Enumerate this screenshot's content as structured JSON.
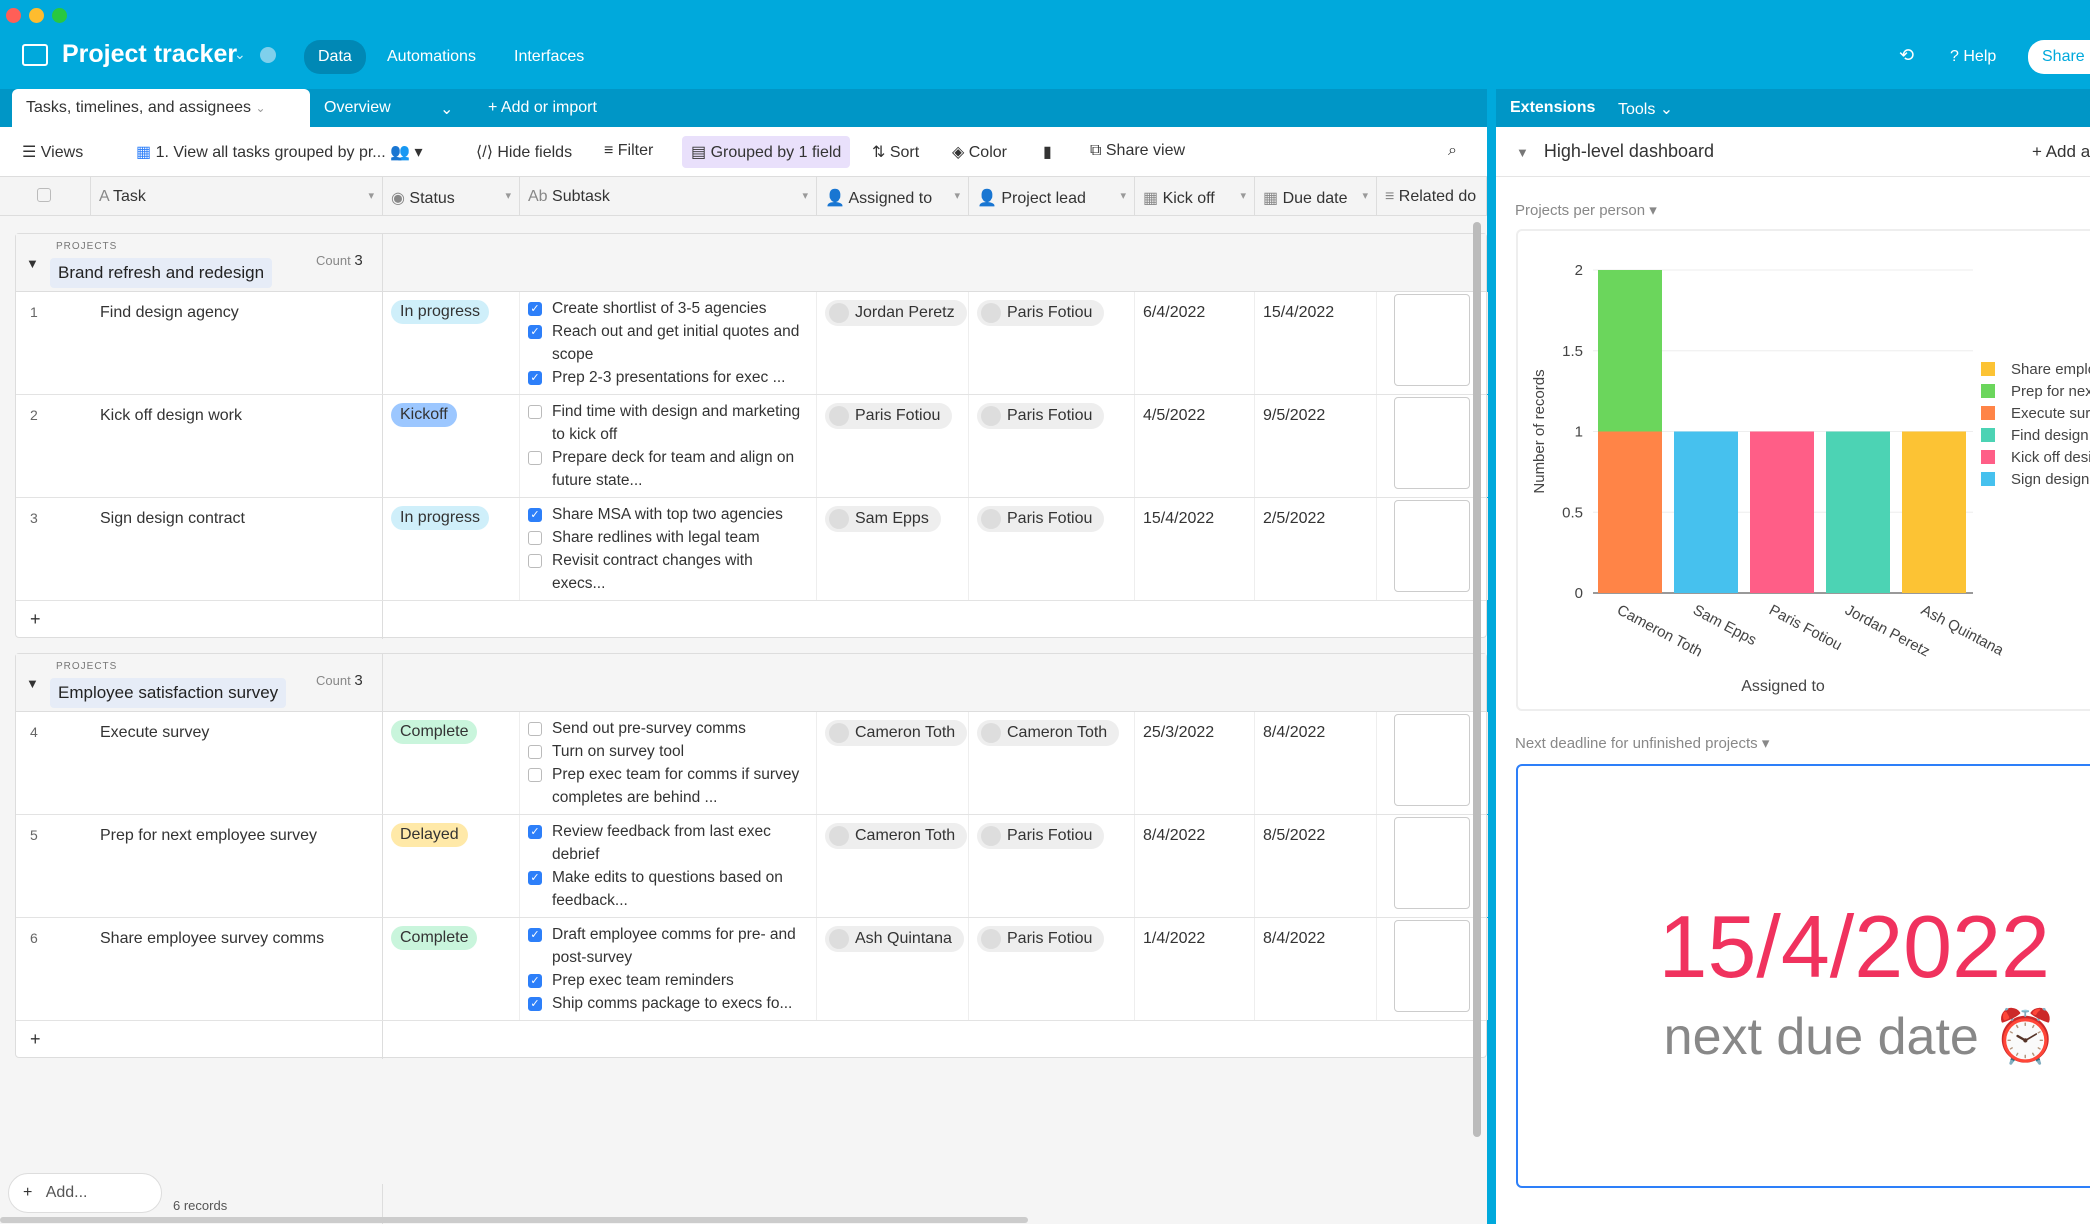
{
  "app": {
    "title": "Project tracker",
    "nav": [
      "Data",
      "Automations",
      "Interfaces"
    ],
    "help": "Help",
    "share": "Share"
  },
  "tabs": {
    "active": "Tasks, timelines, and assignees",
    "overview": "Overview",
    "add": "Add or import"
  },
  "toolbar": {
    "views": "Views",
    "view_name": "1. View all tasks grouped by pr...",
    "hide": "Hide fields",
    "filter": "Filter",
    "grouped": "Grouped by 1 field",
    "sort": "Sort",
    "color": "Color",
    "share": "Share view"
  },
  "columns": [
    "Task",
    "Status",
    "Subtask",
    "Assigned to",
    "Project lead",
    "Kick off",
    "Due date",
    "Related do"
  ],
  "status_colors": {
    "In progress": "#cfeffa",
    "Kickoff": "#9cc7ff",
    "Complete": "#c9f5dc",
    "Delayed": "#ffe9a8"
  },
  "groups": [
    {
      "label": "PROJECTS",
      "name": "Brand refresh and redesign",
      "count_label": "Count",
      "count": "3",
      "rows": [
        {
          "n": "1",
          "task": "Find design agency",
          "status": "In progress",
          "subtasks": [
            {
              "t": "Create shortlist of 3-5 agencies",
              "c": true
            },
            {
              "t": "Reach out and get initial quotes and scope",
              "c": true
            },
            {
              "t": "Prep 2-3 presentations for exec ...",
              "c": true
            }
          ],
          "assigned": "Jordan Peretz",
          "lead": "Paris Fotiou",
          "kickoff": "6/4/2022",
          "due": "15/4/2022"
        },
        {
          "n": "2",
          "task": "Kick off design work",
          "status": "Kickoff",
          "subtasks": [
            {
              "t": "Find time with design and marketing to kick off",
              "c": false
            },
            {
              "t": "Prepare deck for team and align on future state...",
              "c": false
            }
          ],
          "assigned": "Paris Fotiou",
          "lead": "Paris Fotiou",
          "kickoff": "4/5/2022",
          "due": "9/5/2022"
        },
        {
          "n": "3",
          "task": "Sign design contract",
          "status": "In progress",
          "subtasks": [
            {
              "t": "Share MSA with top two agencies",
              "c": true
            },
            {
              "t": "Share redlines with legal team",
              "c": false
            },
            {
              "t": "Revisit contract changes with execs...",
              "c": false
            }
          ],
          "assigned": "Sam Epps",
          "lead": "Paris Fotiou",
          "kickoff": "15/4/2022",
          "due": "2/5/2022"
        }
      ]
    },
    {
      "label": "PROJECTS",
      "name": "Employee satisfaction survey",
      "count_label": "Count",
      "count": "3",
      "rows": [
        {
          "n": "4",
          "task": "Execute survey",
          "status": "Complete",
          "subtasks": [
            {
              "t": "Send out pre-survey comms",
              "c": false
            },
            {
              "t": "Turn on survey tool",
              "c": false
            },
            {
              "t": "Prep exec team for comms if survey completes are behind ...",
              "c": false
            }
          ],
          "assigned": "Cameron Toth",
          "lead": "Cameron Toth",
          "kickoff": "25/3/2022",
          "due": "8/4/2022"
        },
        {
          "n": "5",
          "task": "Prep for next employee survey",
          "status": "Delayed",
          "subtasks": [
            {
              "t": "Review feedback from last exec debrief",
              "c": true
            },
            {
              "t": "Make edits to questions based on feedback...",
              "c": true
            }
          ],
          "assigned": "Cameron Toth",
          "lead": "Paris Fotiou",
          "kickoff": "8/4/2022",
          "due": "8/5/2022"
        },
        {
          "n": "6",
          "task": "Share employee survey comms",
          "status": "Complete",
          "subtasks": [
            {
              "t": "Draft employee comms for pre- and post-survey",
              "c": true
            },
            {
              "t": "Prep exec team reminders",
              "c": true
            },
            {
              "t": "Ship comms package to execs fo...",
              "c": true
            }
          ],
          "assigned": "Ash Quintana",
          "lead": "Paris Fotiou",
          "kickoff": "1/4/2022",
          "due": "8/4/2022"
        }
      ]
    }
  ],
  "footer": {
    "add": "Add...",
    "records": "6 records"
  },
  "ext": {
    "tab": "Extensions",
    "tools": "Tools",
    "dashboard": "High-level dashboard",
    "add": "Add a",
    "chart_title": "Projects per person",
    "deadline_title": "Next deadline for unfinished projects",
    "big_date": "15/4/2022",
    "big_label": "next due date ⏰",
    "big_color": "#f0325e"
  },
  "chart_data": {
    "type": "bar",
    "stacked": true,
    "categories": [
      "Cameron Toth",
      "Sam Epps",
      "Paris Fotiou",
      "Jordan Peretz",
      "Ash Quintana"
    ],
    "xlabel": "Assigned to",
    "ylabel": "Number of records",
    "ylim": [
      0,
      2
    ],
    "yticks": [
      "0",
      "0.5",
      "1",
      "1.5",
      "2"
    ],
    "grid": true,
    "legend": "right",
    "series": [
      {
        "name": "Share employee survey comms",
        "color": "#fcc334",
        "values": [
          0,
          0,
          0,
          0,
          1
        ]
      },
      {
        "name": "Prep for next employee survey",
        "color": "#6bd65c",
        "values": [
          1,
          0,
          0,
          0,
          0
        ]
      },
      {
        "name": "Execute survey",
        "color": "#ff8447",
        "values": [
          1,
          0,
          0,
          0,
          0
        ]
      },
      {
        "name": "Find design agency",
        "color": "#4cd3b4",
        "values": [
          0,
          0,
          0,
          1,
          0
        ]
      },
      {
        "name": "Kick off design work",
        "color": "#ff5e87",
        "values": [
          0,
          0,
          1,
          0,
          0
        ]
      },
      {
        "name": "Sign design contract",
        "color": "#46c1ee",
        "values": [
          0,
          1,
          0,
          0,
          0
        ]
      }
    ]
  }
}
